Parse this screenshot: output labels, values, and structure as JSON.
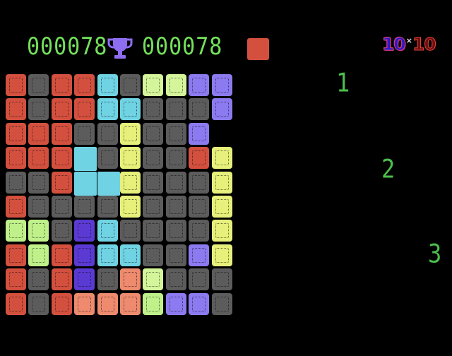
{
  "hud": {
    "score": "000078",
    "best_score": "000078",
    "trophy_icon": "trophy-icon",
    "next_piece_color": "#d3503f"
  },
  "logo": {
    "left": "10",
    "times": "×",
    "right": "10"
  },
  "piece_slots": [
    "1",
    "2",
    "3"
  ],
  "palette": {
    "r": "#d3503f",
    "g": "#5c5c5c",
    "c": "#6fd3e3",
    "C": "#6fd3e3",
    "L": "#d4f59a",
    "l": "#bff08a",
    "p": "#8c7af0",
    "b": "#5a3ad2",
    "y": "#e6f07a",
    "s": "#ee8a6e"
  },
  "board": {
    "rows": [
      "rgrrcgLLpp",
      "rgrrccgggp",
      "rrrggyggp.",
      "rrrCgyggry",
      "ggrCCygggy",
      "rggggygggy",
      "llgbcggggy",
      "rlrbccggpy",
      "rgrbgsLggg",
      "rgrssslppg"
    ]
  }
}
